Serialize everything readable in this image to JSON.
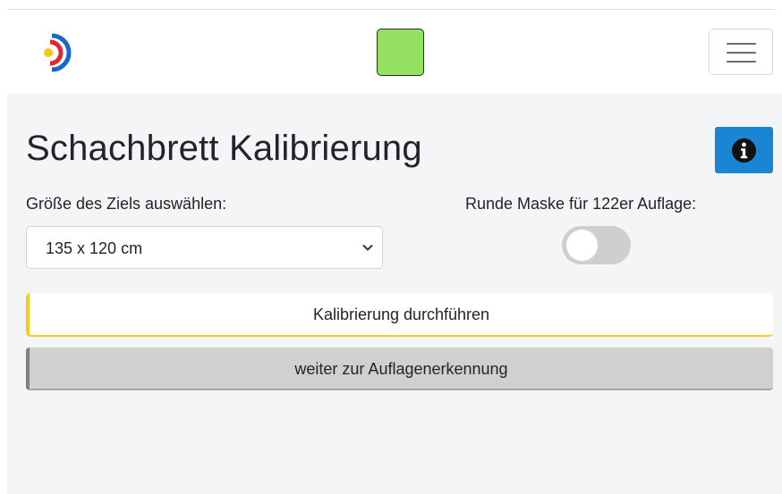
{
  "header": {
    "logo_icon": "target-logo-icon",
    "status_color": "#95e262",
    "menu_icon": "hamburger-menu-icon"
  },
  "main": {
    "title": "Schachbrett Kalibrierung",
    "info_icon": "info-icon",
    "info_button_color": "#1a85d3",
    "target_size": {
      "label": "Größe des Ziels auswählen:",
      "selected": "135 x 120 cm"
    },
    "round_mask": {
      "label": "Runde Maske für 122er Auflage:",
      "enabled": false
    },
    "calibrate_button": {
      "label": "Kalibrierung durchführen",
      "accent": "#f7cc1c"
    },
    "next_button": {
      "label": "weiter zur Auflagenerkennung"
    }
  }
}
